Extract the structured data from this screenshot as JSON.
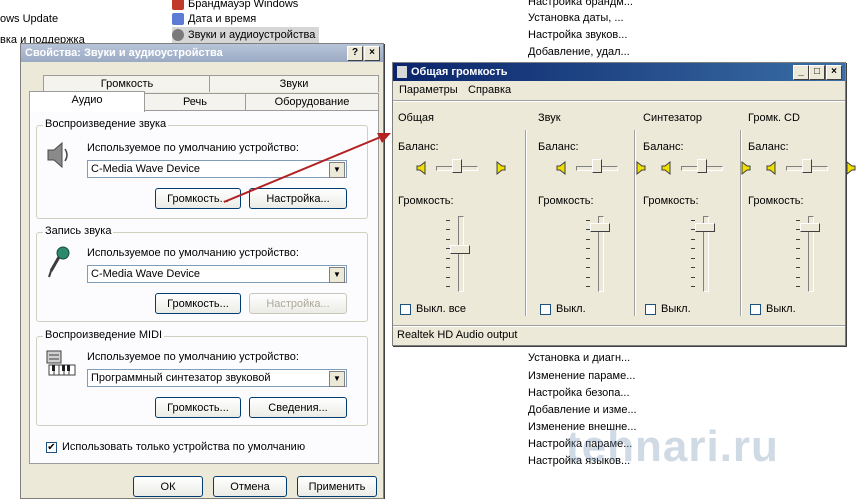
{
  "background": {
    "left_items": [
      "ows Update",
      "вка и поддержка"
    ],
    "cp_items": [
      {
        "label": "Брандмауэр Windows",
        "color": "#c0392b"
      },
      {
        "label": "Дата и время",
        "color": "#5b7bd5"
      },
      {
        "label": "Звуки и аудиоустройства",
        "color": "#7a7a7a"
      }
    ],
    "descriptions_top": [
      "Настройка брандм...",
      "Установка даты, ...",
      "Настройка звуков...",
      "Добавление, удал..."
    ],
    "descriptions_bottom": [
      "Установка и диагн...",
      "Изменение параме...",
      "Настройка безопа...",
      "Добавление и изме...",
      "Изменение внешне...",
      "Настройка параме...",
      "Настройка языков..."
    ],
    "watermark": "tehnari.ru"
  },
  "dialog": {
    "title": "Свойства: Звуки и аудиоустройства",
    "help_btn": "?",
    "close_btn": "×",
    "tabs_row1": [
      "Громкость",
      "Звуки"
    ],
    "tabs_row2": [
      "Аудио",
      "Речь",
      "Оборудование"
    ],
    "playback": {
      "title": "Воспроизведение звука",
      "label": "Используемое по умолчанию устройство:",
      "device": "C-Media Wave Device",
      "volume_btn": "Громкость...",
      "settings_btn": "Настройка..."
    },
    "record": {
      "title": "Запись звука",
      "label": "Используемое по умолчанию устройство:",
      "device": "C-Media Wave Device",
      "volume_btn": "Громкость...",
      "settings_btn": "Настройка..."
    },
    "midi": {
      "title": "Воспроизведение MIDI",
      "label": "Используемое по умолчанию устройство:",
      "device": "Программный синтезатор звуковой",
      "volume_btn": "Громкость...",
      "info_btn": "Сведения..."
    },
    "default_only": "Использовать только устройства по умолчанию",
    "ok": "ОК",
    "cancel": "Отмена",
    "apply": "Применить"
  },
  "mixer": {
    "title": "Общая громкость",
    "menu": [
      "Параметры",
      "Справка"
    ],
    "min_btn": "_",
    "max_btn": "□",
    "close_btn": "×",
    "balance_label": "Баланс:",
    "volume_label": "Громкость:",
    "channels": [
      {
        "name": "Общая",
        "mute": "Выкл. все",
        "level": 0.55
      },
      {
        "name": "Звук",
        "mute": "Выкл.",
        "level": 0.9
      },
      {
        "name": "Синтезатор",
        "mute": "Выкл.",
        "level": 0.9
      },
      {
        "name": "Громк. CD",
        "mute": "Выкл.",
        "level": 0.9
      }
    ],
    "status": "Realtek HD Audio output"
  },
  "colors": {
    "arrow": "#b22222",
    "title_active": "#0a246a"
  }
}
